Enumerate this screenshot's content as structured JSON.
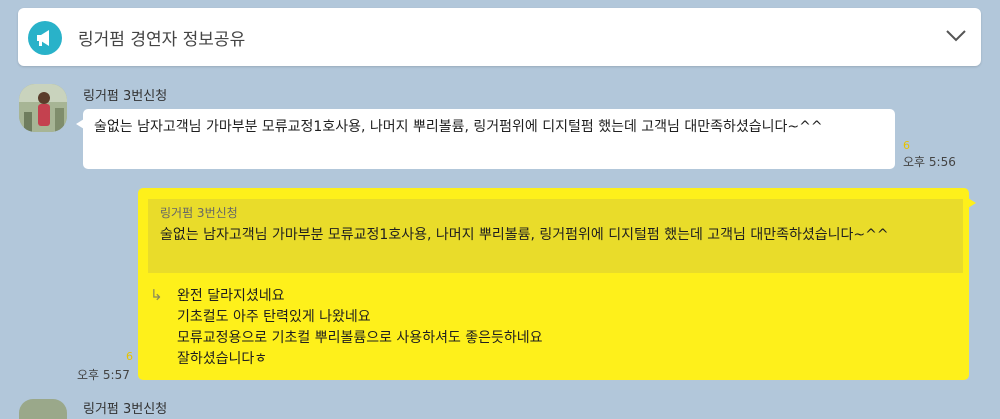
{
  "notice": {
    "icon": "megaphone-icon",
    "title": "링거펌 경연자 정보공유",
    "expand_icon": "chevron-down-icon"
  },
  "messages": [
    {
      "sender": "링거펌 3번신청",
      "text": "술없는 남자고객님 가마부분 모류교정1호사용, 나머지 뿌리볼륨, 링거펌위에 디지털펌 했는데  고객님 대만족하셨습니다~^^",
      "unread": "6",
      "time": "오후 5:56"
    }
  ],
  "reply": {
    "quoted_sender": "링거펌 3번신청",
    "quoted_text": "술없는 남자고객님 가마부분 모류교정1호사용, 나머지 뿌리볼륨, 링거펌위에 디지털펌 했는데  고객님 대만족하셨습니다~^^",
    "lines": [
      "완전 달라지셨네요",
      "기초컬도 아주 탄력있게 나왔네요",
      "모류교정용으로 기초컬 뿌리볼륨으로 사용하셔도 좋은듯하네요",
      "잘하셨습니다ㅎ"
    ],
    "unread": "6",
    "time": "오후 5:57"
  },
  "next_message": {
    "sender": "링거펌 3번신청"
  }
}
